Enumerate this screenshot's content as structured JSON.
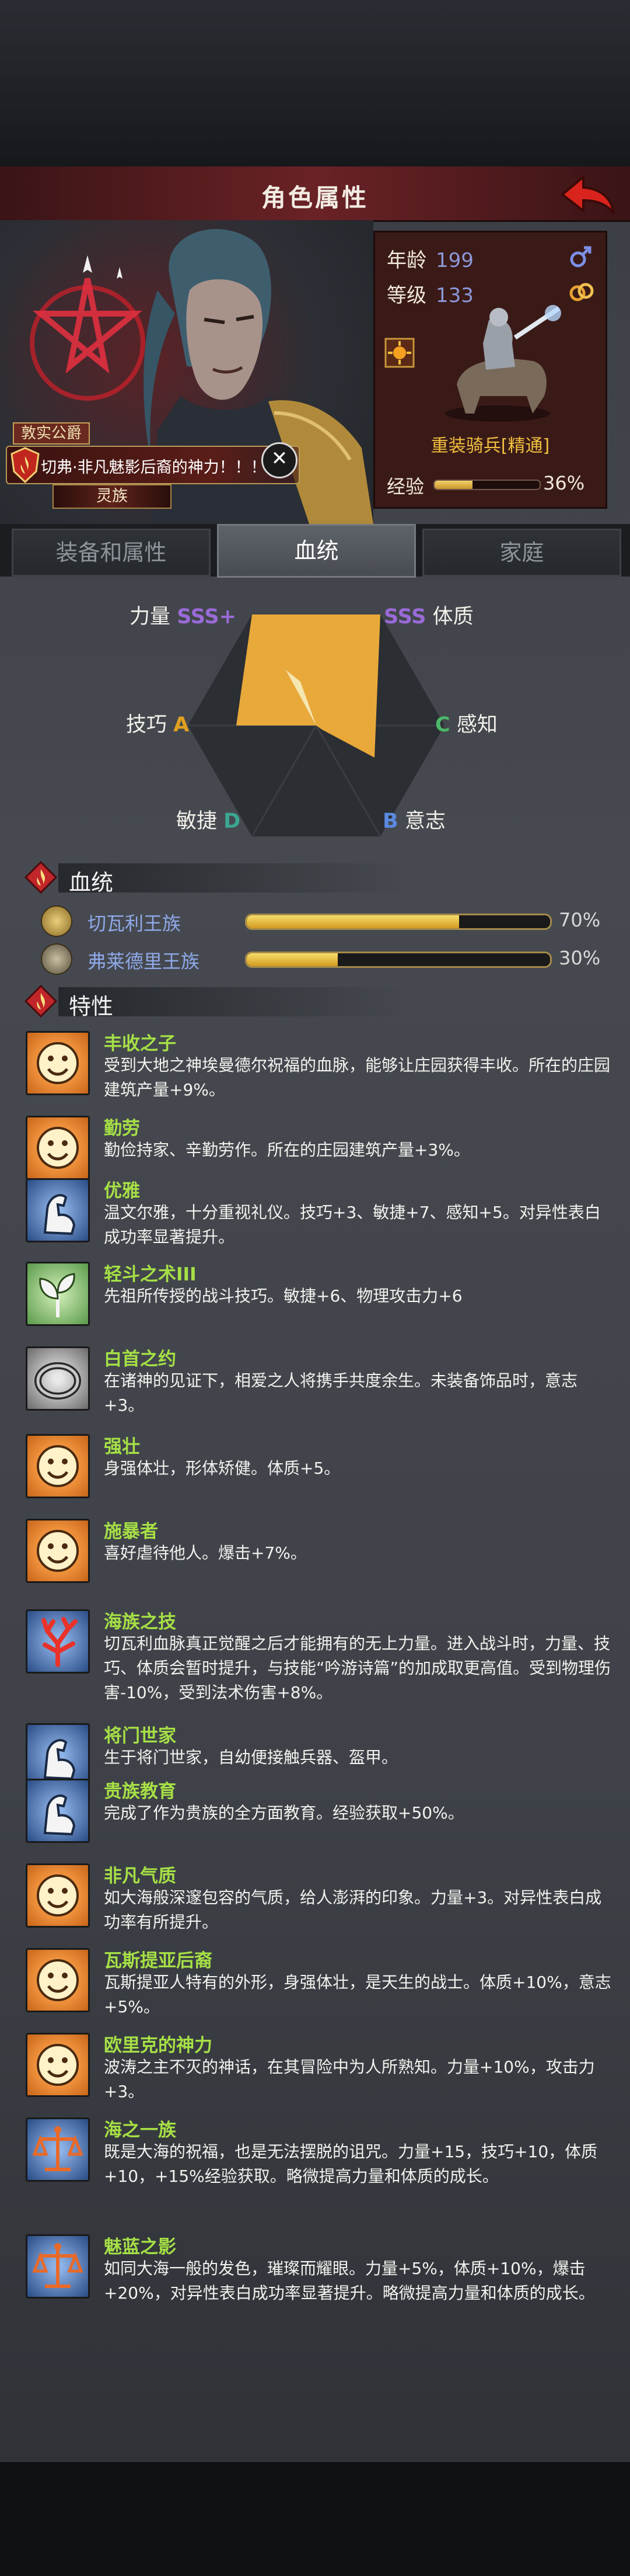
{
  "header": {
    "title": "角色属性"
  },
  "hero": {
    "faction_badge": "敦实公爵",
    "lineage_title": "切弗·非凡魅影后裔的神力！！！",
    "race": "灵族"
  },
  "stats": {
    "age_label": "年龄",
    "age_value": "199",
    "level_label": "等级",
    "level_value": "133",
    "unit_name": "重装骑兵[精通]",
    "xp_label": "经验",
    "xp_percent": "36%",
    "xp_fraction": 0.36
  },
  "tabs": [
    "装备和属性",
    "血统",
    "家庭"
  ],
  "active_tab": 1,
  "radar": {
    "axes": [
      {
        "label": "力量",
        "grade": "SSS+",
        "grade_color": "#9a6ad8"
      },
      {
        "label": "体质",
        "grade": "SSS",
        "grade_color": "#9a6ad8"
      },
      {
        "label": "感知",
        "grade": "C",
        "grade_color": "#4cb86a"
      },
      {
        "label": "意志",
        "grade": "B",
        "grade_color": "#5a8ae0"
      },
      {
        "label": "敏捷",
        "grade": "D",
        "grade_color": "#3aa890"
      },
      {
        "label": "技巧",
        "grade": "A",
        "grade_color": "#e0a020"
      }
    ],
    "fill_color": "#e8a93a"
  },
  "sections": {
    "bloodline": "血统",
    "traits": "特性"
  },
  "bloodlines": [
    {
      "name": "切瓦利王族",
      "percent": "70%",
      "fraction": 0.7
    },
    {
      "name": "弗莱德里王族",
      "percent": "30%",
      "fraction": 0.3
    }
  ],
  "traits": [
    {
      "name": "丰收之子",
      "desc": "受到大地之神埃曼德尔祝福的血脉，能够让庄园获得丰收。所在的庄园建筑产量+9%。",
      "icon": "smile-face-icon",
      "style": "orange"
    },
    {
      "name": "勤劳",
      "desc": "勤俭持家、辛勤劳作。所在的庄园建筑产量+3%。",
      "icon": "smile-face-icon",
      "style": "orange"
    },
    {
      "name": "优雅",
      "desc": "温文尔雅，十分重视礼仪。技巧+3、敏捷+7、感知+5。对异性表白成功率显著提升。",
      "icon": "strong-arm-icon",
      "style": "blue"
    },
    {
      "name": "轻斗之术III",
      "desc": "先祖所传授的战斗技巧。敏捷+6、物理攻击力+6",
      "icon": "leaf-icon",
      "style": "green"
    },
    {
      "name": "白首之约",
      "desc": "在诸神的见证下，相爱之人将携手共度余生。未装备饰品时，意志+3。",
      "icon": "ring-icon",
      "style": "grey"
    },
    {
      "name": "强壮",
      "desc": "身强体壮，形体矫健。体质+5。",
      "icon": "smile-face-icon",
      "style": "orange"
    },
    {
      "name": "施暴者",
      "desc": "喜好虐待他人。爆击+7%。",
      "icon": "smile-face-icon",
      "style": "orange"
    },
    {
      "name": "海族之技",
      "desc": "切瓦利血脉真正觉醒之后才能拥有的无上力量。进入战斗时，力量、技巧、体质会暂时提升，与技能“吟游诗篇”的加成取更高值。受到物理伤害-10%，受到法术伤害+8%。",
      "icon": "coral-icon",
      "style": "blue"
    },
    {
      "name": "将门世家",
      "desc": "生于将门世家，自幼便接触兵器、盔甲。",
      "icon": "strong-arm-icon",
      "style": "blue"
    },
    {
      "name": "贵族教育",
      "desc": "完成了作为贵族的全方面教育。经验获取+50%。",
      "icon": "strong-arm-icon",
      "style": "blue"
    },
    {
      "name": "非凡气质",
      "desc": "如大海般深邃包容的气质，给人澎湃的印象。力量+3。对异性表白成功率有所提升。",
      "icon": "smile-face-icon",
      "style": "orange"
    },
    {
      "name": "瓦斯提亚后裔",
      "desc": "瓦斯提亚人特有的外形，身强体壮，是天生的战士。体质+10%，意志+5%。",
      "icon": "smile-face-icon",
      "style": "orange"
    },
    {
      "name": "欧里克的神力",
      "desc": "波涛之主不灭的神话，在其冒险中为人所熟知。力量+10%，攻击力+3。",
      "icon": "smile-face-icon",
      "style": "orange"
    },
    {
      "name": "海之一族",
      "desc": "既是大海的祝福，也是无法摆脱的诅咒。力量+15，技巧+10，体质+10，+15%经验获取。略微提高力量和体质的成长。",
      "icon": "scales-icon",
      "style": "blue"
    },
    {
      "name": "魅蓝之影",
      "desc": "如同大海一般的发色，璀璨而耀眼。力量+5%，体质+10%，爆击+20%，对异性表白成功率显著提升。略微提高力量和体质的成长。",
      "icon": "scales-icon",
      "style": "blue"
    }
  ]
}
